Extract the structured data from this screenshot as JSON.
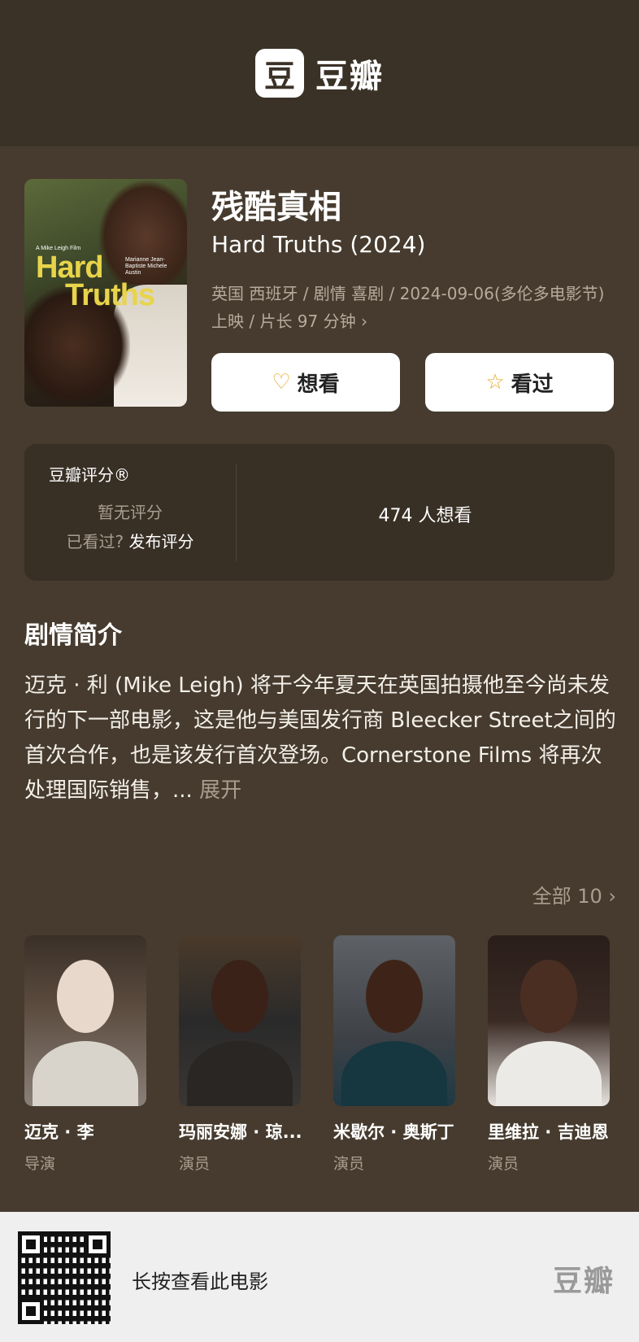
{
  "header": {
    "logo_glyph": "豆",
    "logo_text": "豆瓣"
  },
  "movie": {
    "poster": {
      "credit": "A Mike Leigh Film",
      "title_line1": "Hard",
      "title_line2": "Truths",
      "cast": "Marianne Jean-Baptiste Michele Austin"
    },
    "title_cn": "残酷真相",
    "title_en": "Hard Truths (2024)",
    "meta": "英国 西班牙 / 剧情 喜剧 / 2024-09-06(多伦多电影节) 上映 / 片长 97 分钟 ›"
  },
  "actions": {
    "want_label": "想看",
    "seen_label": "看过"
  },
  "rating": {
    "label": "豆瓣评分®",
    "no_rating": "暂无评分",
    "seen_prefix": "已看过?",
    "publish": "发布评分",
    "want_count": "474 人想看"
  },
  "synopsis": {
    "title": "剧情简介",
    "text": "迈克 · 利 (Mike Leigh) 将于今年夏天在英国拍摄他至今尚未发行的下一部电影，这是他与美国发行商 Bleecker Street之间的首次合作，也是该发行首次登场。Cornerstone Films 将再次处理国际销售，... ",
    "expand": "展开"
  },
  "cast_section": {
    "all_link": "全部 10 ›"
  },
  "cast": [
    {
      "name": "迈克 · 李",
      "role": "导演"
    },
    {
      "name": "玛丽安娜 · 琼...",
      "role": "演员"
    },
    {
      "name": "米歇尔 · 奥斯丁",
      "role": "演员"
    },
    {
      "name": "里维拉 · 吉迪恩",
      "role": "演员"
    }
  ],
  "footer": {
    "text": "长按查看此电影",
    "logo": "豆瓣"
  }
}
